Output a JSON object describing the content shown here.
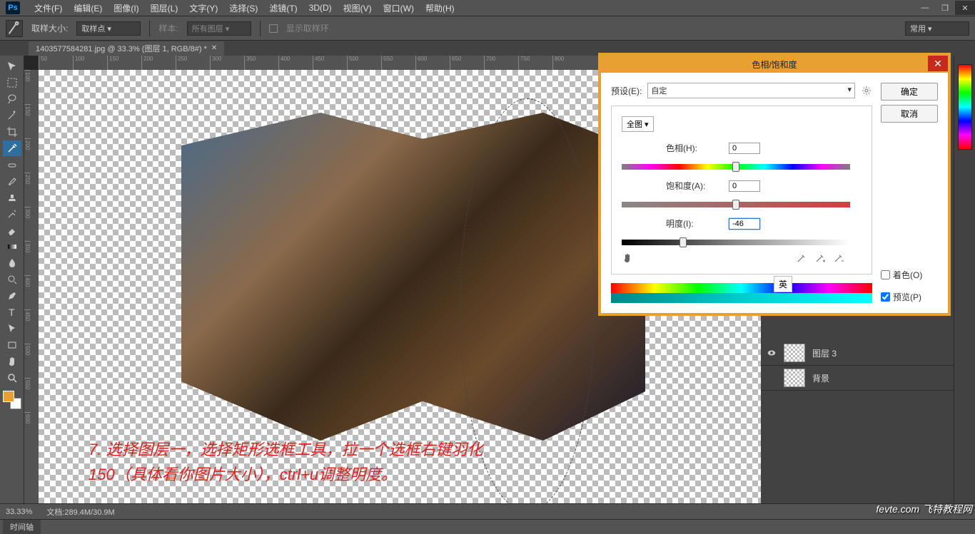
{
  "menubar": {
    "logo": "Ps",
    "items": [
      "文件(F)",
      "编辑(E)",
      "图像(I)",
      "图层(L)",
      "文字(Y)",
      "选择(S)",
      "滤镜(T)",
      "3D(D)",
      "视图(V)",
      "窗口(W)",
      "帮助(H)"
    ]
  },
  "optbar": {
    "sample_size_label": "取样大小:",
    "sample_size_value": "取样点",
    "sample_label": "样本:",
    "sample_value": "所有图层",
    "show_ring": "显示取样环",
    "right_dd": "常用"
  },
  "tab": {
    "title": "1403577584281.jpg @ 33.3% (图层 1, RGB/8#) *"
  },
  "ruler_h": [
    "50",
    "100",
    "150",
    "200",
    "250",
    "300",
    "350",
    "400",
    "450",
    "500",
    "550",
    "600",
    "650",
    "700",
    "750",
    "800"
  ],
  "ruler_v": [
    "100",
    "150",
    "200",
    "250",
    "300",
    "350",
    "400",
    "450",
    "500",
    "550",
    "600"
  ],
  "annotation": {
    "line1": "7. 选择图层一，选择矩形选框工具，拉一个选框右键羽化",
    "line2": "150（具体看你图片大小），ctrl+u调整明度。"
  },
  "layers": {
    "row1": "图层 3",
    "row2": "背景"
  },
  "status": {
    "zoom": "33.33%",
    "doc": "文档:289.4M/30.9M",
    "timeline": "时间轴"
  },
  "dialog": {
    "title": "色相/饱和度",
    "preset_label": "预设(E):",
    "preset_value": "自定",
    "range_value": "全图",
    "hue_label": "色相(H):",
    "hue_value": "0",
    "sat_label": "饱和度(A):",
    "sat_value": "0",
    "lig_label": "明度(I):",
    "lig_value": "-46",
    "ok": "确定",
    "cancel": "取消",
    "colorize": "着色(O)",
    "preview": "预览(P)",
    "ime": "英"
  },
  "watermark": "fevte.com 飞特教程网",
  "colors": {
    "accent": "#e8a030",
    "close_red": "#c42b1c"
  }
}
